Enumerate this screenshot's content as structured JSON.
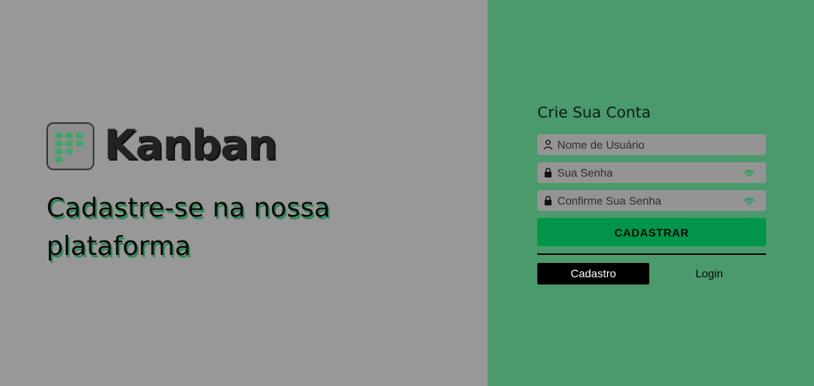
{
  "brand": {
    "name": "Kanban",
    "icon": "kanban-board-icon",
    "accent": "#3a9a62"
  },
  "hero": {
    "headline": "Cadastre-se na nossa plataforma"
  },
  "form": {
    "title": "Crie Sua Conta",
    "username": {
      "placeholder": "Nome de Usuário",
      "value": "",
      "icon": "user-icon"
    },
    "password": {
      "placeholder": "Sua Senha",
      "value": "",
      "icon": "lock-icon",
      "toggle_icon": "eye-icon"
    },
    "confirm_password": {
      "placeholder": "Confirme Sua Senha",
      "value": "",
      "icon": "lock-icon",
      "toggle_icon": "eye-icon"
    },
    "submit_label": "CADASTRAR"
  },
  "tabs": [
    {
      "label": "Cadastro",
      "active": true
    },
    {
      "label": "Login",
      "active": false
    }
  ],
  "colors": {
    "left_bg": "#989898",
    "right_bg": "#4a9a6b",
    "input_bg": "#949494",
    "primary_button": "#00954a",
    "active_tab": "#000000"
  }
}
